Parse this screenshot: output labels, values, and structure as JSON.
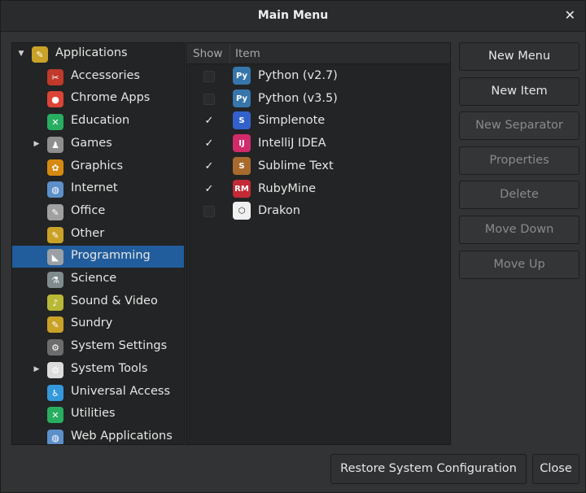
{
  "window": {
    "title": "Main Menu",
    "close_glyph": "✕"
  },
  "tree": {
    "items": [
      {
        "label": "Applications",
        "icon": "applications-icon",
        "glyph": "✎",
        "color": "#c9a227",
        "expander": "expanded",
        "level": 0
      },
      {
        "label": "Accessories",
        "icon": "accessories-icon",
        "glyph": "✂",
        "color": "#c0392b",
        "level": 1
      },
      {
        "label": "Chrome Apps",
        "icon": "chrome-icon",
        "glyph": "●",
        "color": "#db4437",
        "level": 1
      },
      {
        "label": "Education",
        "icon": "education-icon",
        "glyph": "✕",
        "color": "#27ae60",
        "level": 1
      },
      {
        "label": "Games",
        "icon": "games-icon",
        "glyph": "♟",
        "color": "#8e8e8e",
        "expander": "collapsed",
        "level": 1
      },
      {
        "label": "Graphics",
        "icon": "graphics-icon",
        "glyph": "✿",
        "color": "#d68910",
        "level": 1
      },
      {
        "label": "Internet",
        "icon": "internet-icon",
        "glyph": "◍",
        "color": "#5d8fc9",
        "level": 1
      },
      {
        "label": "Office",
        "icon": "office-icon",
        "glyph": "✎",
        "color": "#a0a0a0",
        "level": 1
      },
      {
        "label": "Other",
        "icon": "other-icon",
        "glyph": "✎",
        "color": "#c9a227",
        "level": 1
      },
      {
        "label": "Programming",
        "icon": "programming-icon",
        "glyph": "◣",
        "color": "#9aa0a6",
        "level": 1,
        "selected": true
      },
      {
        "label": "Science",
        "icon": "science-icon",
        "glyph": "⚗",
        "color": "#7f8c8d",
        "level": 1
      },
      {
        "label": "Sound & Video",
        "icon": "sound-video-icon",
        "glyph": "♪",
        "color": "#b8b837",
        "level": 1
      },
      {
        "label": "Sundry",
        "icon": "sundry-icon",
        "glyph": "✎",
        "color": "#c9a227",
        "level": 1
      },
      {
        "label": "System Settings",
        "icon": "system-settings-icon",
        "glyph": "⚙",
        "color": "#6c6c6c",
        "level": 1
      },
      {
        "label": "System Tools",
        "icon": "system-tools-icon",
        "glyph": "⚙",
        "color": "#dcdcdc",
        "expander": "collapsed",
        "level": 1
      },
      {
        "label": "Universal Access",
        "icon": "universal-access-icon",
        "glyph": "♿",
        "color": "#3498db",
        "level": 1
      },
      {
        "label": "Utilities",
        "icon": "utilities-icon",
        "glyph": "✕",
        "color": "#27ae60",
        "level": 1
      },
      {
        "label": "Web Applications",
        "icon": "web-applications-icon",
        "glyph": "◍",
        "color": "#5d8fc9",
        "level": 1
      }
    ]
  },
  "items_list": {
    "header_show": "Show",
    "header_item": "Item",
    "rows": [
      {
        "label": "Python (v2.7)",
        "checked": false,
        "icon": "python-icon",
        "glyph": "Py",
        "color": "#3776ab"
      },
      {
        "label": "Python (v3.5)",
        "checked": false,
        "icon": "python-icon",
        "glyph": "Py",
        "color": "#3776ab"
      },
      {
        "label": "Simplenote",
        "checked": true,
        "icon": "simplenote-icon",
        "glyph": "S",
        "color": "#3361cc"
      },
      {
        "label": "IntelliJ IDEA",
        "checked": true,
        "icon": "intellij-icon",
        "glyph": "IJ",
        "color": "#d12b6b"
      },
      {
        "label": "Sublime Text",
        "checked": true,
        "icon": "sublime-icon",
        "glyph": "S",
        "color": "#a86a2d"
      },
      {
        "label": "RubyMine",
        "checked": true,
        "icon": "rubymine-icon",
        "glyph": "RM",
        "color": "#c42a35"
      },
      {
        "label": "Drakon",
        "checked": false,
        "icon": "drakon-icon",
        "glyph": "⬡",
        "color": "#f0f0f0"
      }
    ],
    "check_glyph": "✓"
  },
  "actions": {
    "new_menu": "New Menu",
    "new_item": "New Item",
    "new_separator": "New Separator",
    "properties": "Properties",
    "delete": "Delete",
    "move_down": "Move Down",
    "move_up": "Move Up"
  },
  "footer": {
    "restore": "Restore System Configuration",
    "close": "Close"
  }
}
